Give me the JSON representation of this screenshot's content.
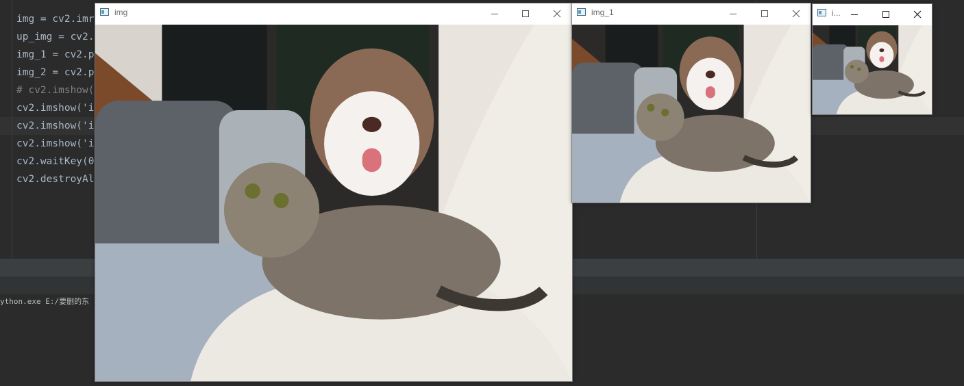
{
  "editor": {
    "lines": [
      {
        "text": "img = cv2.imr",
        "type": "code"
      },
      {
        "text": "up_img = cv2.",
        "type": "code"
      },
      {
        "text": "img_1 = cv2.p",
        "type": "code"
      },
      {
        "text": "img_2 = cv2.p",
        "type": "code"
      },
      {
        "text": "# cv2.imshow(",
        "type": "comment"
      },
      {
        "text": "cv2.imshow('i",
        "type": "code"
      },
      {
        "text": "cv2.imshow('i",
        "type": "code"
      },
      {
        "text": "cv2.imshow('i",
        "type": "code"
      },
      {
        "text": "cv2.waitKey(0",
        "type": "code"
      },
      {
        "text": "cv2.destroyAl",
        "type": "code"
      }
    ]
  },
  "console": {
    "text": "ython.exe E:/要删的东"
  },
  "windows": [
    {
      "id": "img",
      "title": "img"
    },
    {
      "id": "img_1",
      "title": "img_1"
    },
    {
      "id": "img_2",
      "title": "i..."
    }
  ],
  "window_controls": {
    "minimize": "minimize-icon",
    "maximize": "maximize-icon",
    "close": "close-icon"
  },
  "colors": {
    "ide_background": "#2b2b2b",
    "code_text": "#a9b7c6",
    "comment": "#808080",
    "window_title": "#6d6d6d"
  }
}
